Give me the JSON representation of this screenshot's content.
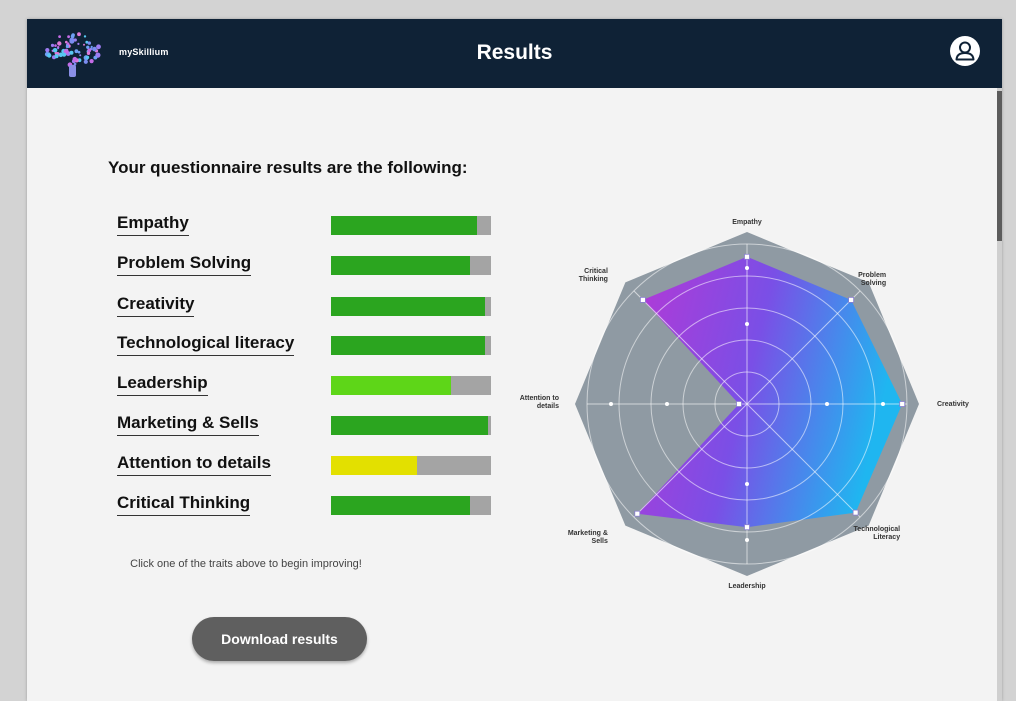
{
  "header": {
    "brand": "mySkillium",
    "title": "Results"
  },
  "main": {
    "heading": "Your questionnaire results are the following:",
    "hint": "Click one of the traits above to begin improving!",
    "download_label": "Download results"
  },
  "traits": [
    {
      "label": "Empathy",
      "score": 0.91,
      "color": "#2ba51f"
    },
    {
      "label": "Problem Solving",
      "score": 0.87,
      "color": "#2ba51f"
    },
    {
      "label": "Creativity",
      "score": 0.96,
      "color": "#2ba51f"
    },
    {
      "label": "Technological literacy",
      "score": 0.96,
      "color": "#2ba51f"
    },
    {
      "label": "Leadership",
      "score": 0.75,
      "color": "#5ed618"
    },
    {
      "label": "Marketing & Sells",
      "score": 0.98,
      "color": "#2ba51f"
    },
    {
      "label": "Attention to details",
      "score": 0.54,
      "color": "#e3e000"
    },
    {
      "label": "Critical Thinking",
      "score": 0.87,
      "color": "#2ba51f"
    }
  ],
  "chart_data": {
    "type": "radar",
    "axes": [
      "Empathy",
      "Problem Solving",
      "Creativity",
      "Technological Literacy",
      "Leadership",
      "Marketing & Sells",
      "Attention to details",
      "Critical Thinking"
    ],
    "axis_labels": [
      "Empathy",
      "Problem\nSolving",
      "Creativity",
      "Technological\nLiteracy",
      "Leadership",
      "Marketing &\nSells",
      "Attention to\ndetails",
      "Critical\nThinking"
    ],
    "values": [
      0.92,
      0.92,
      0.97,
      0.96,
      0.77,
      0.97,
      0.05,
      0.92
    ],
    "range": [
      0,
      1
    ],
    "rings": 5,
    "colors": {
      "frame": "#8f9aa3",
      "fill_left": "#b339d6",
      "fill_mid": "#7a4fe6",
      "fill_right": "#1fb6f0"
    }
  }
}
